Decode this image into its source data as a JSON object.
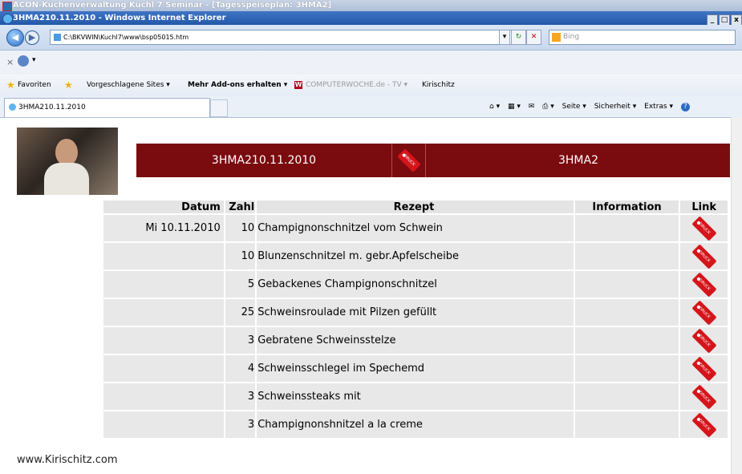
{
  "app_window": {
    "title": "ACON-Küchenverwaltung  Kuchl 7  Seminar - [Tagesspeiseplan: 3HMA2]"
  },
  "ie_window": {
    "title": "3HMA210.11.2010 - Windows Internet Explorer",
    "address": "C:\\BKVWIN\\Kuchl7\\www\\bsp05015.htm",
    "search_placeholder": "Bing",
    "fav_items": [
      "Favoriten",
      "Vorgeschlagene Sites ▾",
      "Mehr Add-ons erhalten ▾",
      "COMPUTERWOCHE.de - TV ▾",
      "Kirischitz"
    ],
    "tab_label": "3HMA210.11.2010",
    "command_bar": [
      "Seite ▾",
      "Sicherheit ▾",
      "Extras ▾"
    ]
  },
  "page": {
    "header_left": "3HMA210.11.2010",
    "header_right": "3HMA2",
    "footer": "www.Kirischitz.com",
    "columns": {
      "datum": "Datum",
      "zahl": "Zahl",
      "rezept": "Rezept",
      "information": "Information",
      "link": "Link"
    },
    "rows": [
      {
        "datum": "Mi 10.11.2010",
        "zahl": "10",
        "rezept": "Champignonschnitzel vom Schwein",
        "information": ""
      },
      {
        "datum": "",
        "zahl": "10",
        "rezept": "Blunzenschnitzel m. gebr.Apfelscheibe",
        "information": ""
      },
      {
        "datum": "",
        "zahl": "5",
        "rezept": "Gebackenes Champignonschnitzel",
        "information": ""
      },
      {
        "datum": "",
        "zahl": "25",
        "rezept": "Schweinsroulade mit Pilzen gefüllt",
        "information": ""
      },
      {
        "datum": "",
        "zahl": "3",
        "rezept": "Gebratene Schweinsstelze",
        "information": ""
      },
      {
        "datum": "",
        "zahl": "4",
        "rezept": "Schweinsschlegel im Spechemd",
        "information": ""
      },
      {
        "datum": "",
        "zahl": "3",
        "rezept": "Schweinssteaks mit",
        "information": ""
      },
      {
        "datum": "",
        "zahl": "3",
        "rezept": "Champignonshnitzel a la creme",
        "information": ""
      }
    ]
  },
  "colors": {
    "banner": "#7a0b0f",
    "tag": "#d5141b",
    "ie_title": "#2458a8"
  }
}
